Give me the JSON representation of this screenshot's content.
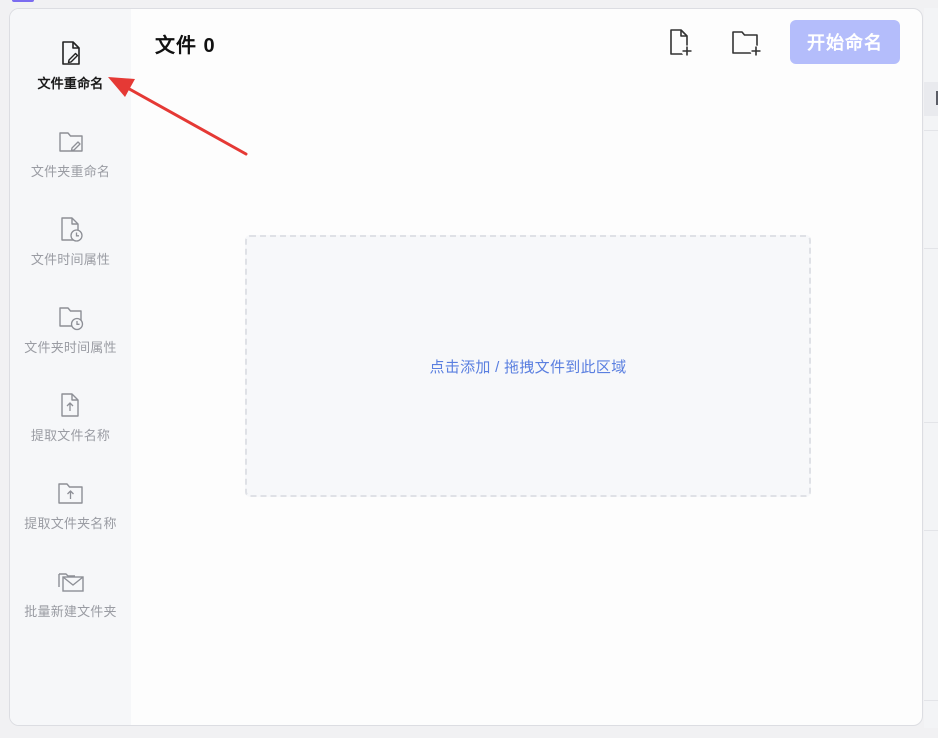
{
  "sidebar": {
    "items": [
      {
        "label": "文件重命名",
        "icon": "file-edit-icon",
        "active": true
      },
      {
        "label": "文件夹重命名",
        "icon": "folder-edit-icon"
      },
      {
        "label": "文件时间属性",
        "icon": "file-clock-icon"
      },
      {
        "label": "文件夹时间属性",
        "icon": "folder-clock-icon"
      },
      {
        "label": "提取文件名称",
        "icon": "file-upload-icon"
      },
      {
        "label": "提取文件夹名称",
        "icon": "folder-upload-icon"
      },
      {
        "label": "批量新建文件夹",
        "icon": "folder-mail-icon"
      }
    ]
  },
  "header": {
    "title": "文件 0",
    "add_file_icon": "file-plus-icon",
    "add_folder_icon": "folder-plus-icon",
    "start_button_label": "开始命名"
  },
  "dropzone": {
    "text": "点击添加 / 拖拽文件到此区域"
  },
  "colors": {
    "accent": "#b4bdfb",
    "dropzone_text": "#5a7fe0",
    "annotation_arrow": "#e53935"
  }
}
